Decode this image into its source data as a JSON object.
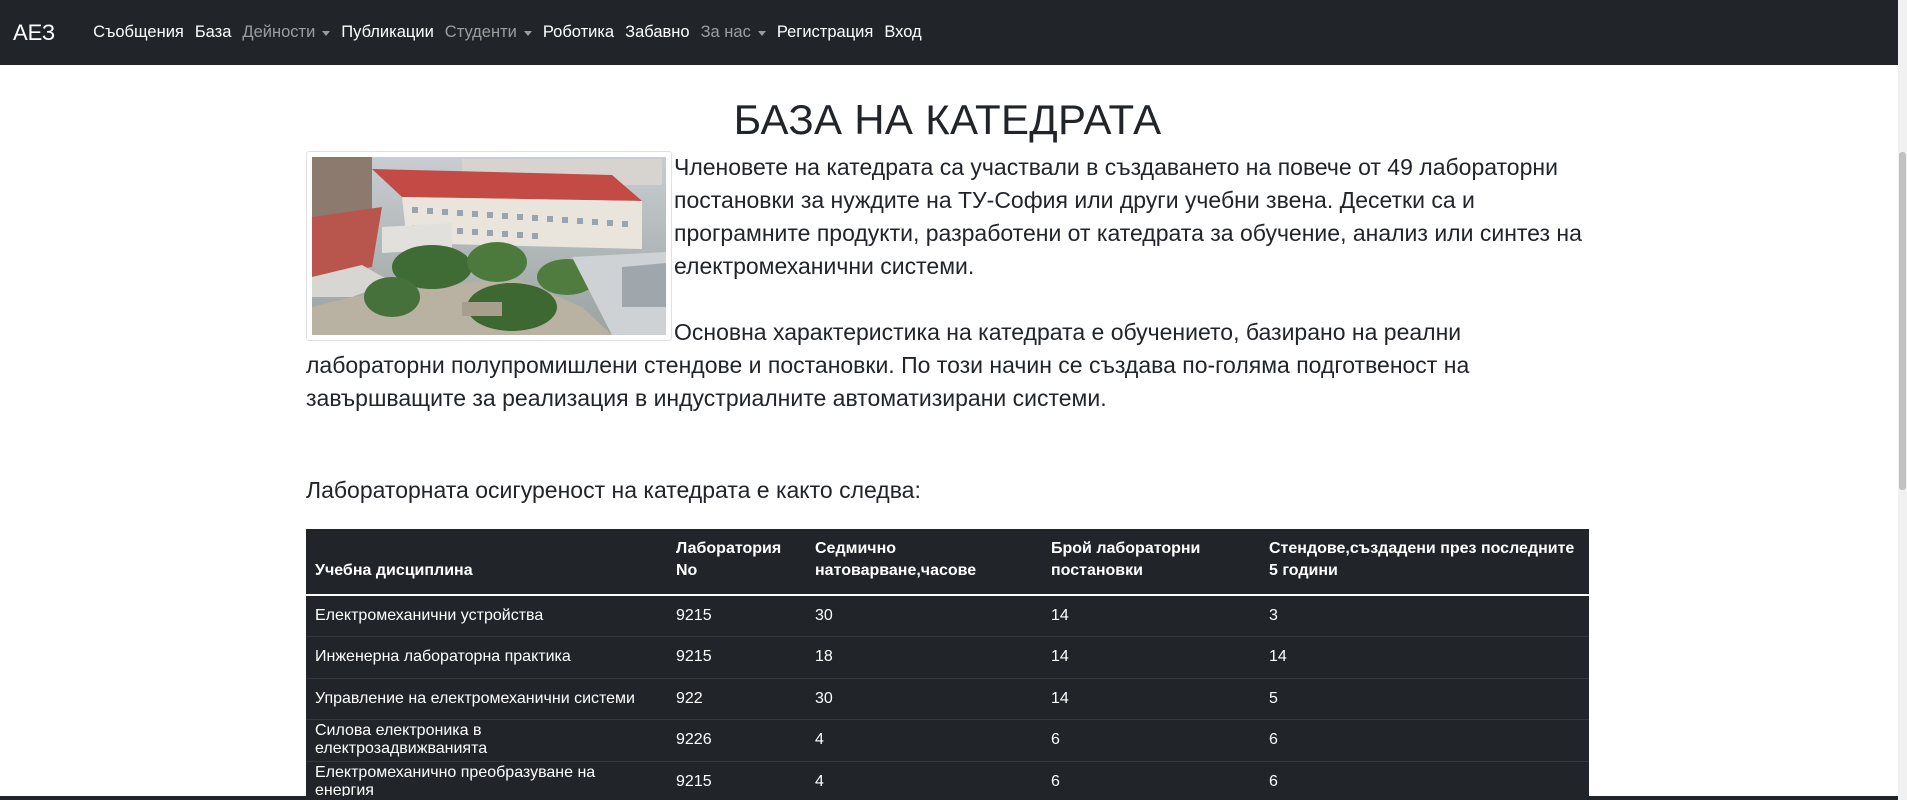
{
  "navbar": {
    "brand": "АЕЗ",
    "items": [
      {
        "label": "Съобщения",
        "dropdown": false,
        "muted": false
      },
      {
        "label": "База",
        "dropdown": false,
        "muted": false
      },
      {
        "label": "Дейности",
        "dropdown": true,
        "muted": true
      },
      {
        "label": "Публикации",
        "dropdown": false,
        "muted": false
      },
      {
        "label": "Студенти",
        "dropdown": true,
        "muted": true
      },
      {
        "label": "Роботика",
        "dropdown": false,
        "muted": false
      },
      {
        "label": "Забавно",
        "dropdown": false,
        "muted": false
      },
      {
        "label": "За нас",
        "dropdown": true,
        "muted": true
      },
      {
        "label": "Регистрация",
        "dropdown": false,
        "muted": false
      },
      {
        "label": "Вход",
        "dropdown": false,
        "muted": false
      }
    ]
  },
  "page": {
    "title": "БАЗА НА КАТЕДРАТА",
    "paragraph1": "Членовете на катедрата са участвали в създаването на повече от 49 лабораторни постановки за нуждите на ТУ-София или други учебни звена. Десетки са и програмните продукти, разработени от катедрата за обучение, анализ или синтез на електромеханични системи.",
    "paragraph2": "Основна характеристика на катедрата е обучението, базирано на реални лабораторни полупромишлени стендове и постановки. По този начин се създава по-голяма подготвеност на завършващите за реализация в индустриалните автоматизирани системи.",
    "lab_intro": "Лабораторната осигуреност на катедрата е както следва:"
  },
  "table": {
    "headers": [
      "Учебна дисциплина",
      "Лаборатория No",
      "Седмично натоварване,часове",
      "Брой лабораторни постановки",
      "Стендове,създадени през последните 5 години"
    ],
    "rows": [
      [
        "Електромеханични устройства",
        "9215",
        "30",
        "14",
        "3"
      ],
      [
        "Инженерна лабораторна практика",
        "9215",
        "18",
        "14",
        "14"
      ],
      [
        "Управление на електромеханични системи",
        "922",
        "30",
        "14",
        "5"
      ],
      [
        "Силова електроника в електрозадвижванията",
        "9226",
        "4",
        "6",
        "6"
      ],
      [
        "Електромеханично преобразуване на енергия",
        "9215",
        "4",
        "6",
        "6"
      ]
    ]
  },
  "colors": {
    "navbar_bg": "#212529",
    "table_bg": "#212529",
    "text": "#212529",
    "muted_nav": "rgba(255,255,255,0.55)"
  }
}
